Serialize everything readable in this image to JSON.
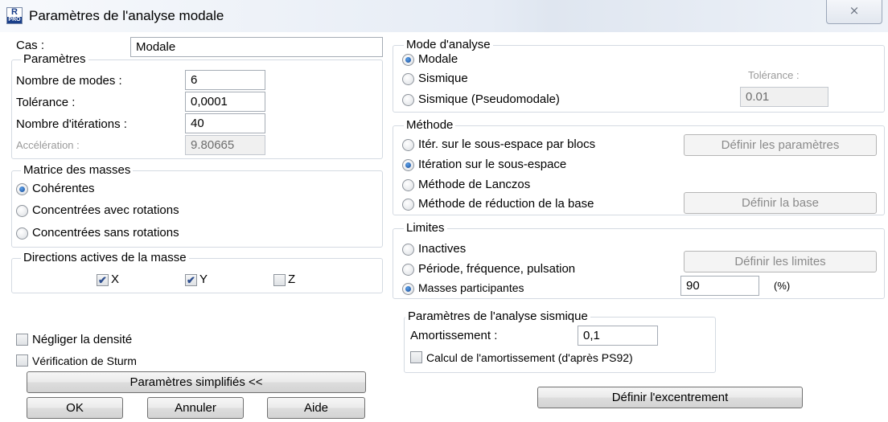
{
  "window": {
    "app_icon_top": "R",
    "app_icon_bottom": "PRO",
    "title": "Paramètres de l'analyse modale",
    "close": "⨯"
  },
  "cas": {
    "label": "Cas :",
    "value": "Modale"
  },
  "parametres": {
    "title": "Paramètres",
    "nb_modes_label": "Nombre de modes :",
    "nb_modes_value": "6",
    "tolerance_label": "Tolérance :",
    "tolerance_value": "0,0001",
    "iterations_label": "Nombre d'itérations :",
    "iterations_value": "40",
    "acceleration_label": "Accélération :",
    "acceleration_value": "9.80665"
  },
  "matrice": {
    "title": "Matrice des masses",
    "options": [
      "Cohérentes",
      "Concentrées avec rotations",
      "Concentrées sans rotations"
    ],
    "selected": "Cohérentes"
  },
  "directions": {
    "title": "Directions actives de la masse",
    "x_label": "X",
    "x_checked": true,
    "y_label": "Y",
    "y_checked": true,
    "z_label": "Z",
    "z_checked": false
  },
  "options": {
    "negliger_label": "Négliger la densité",
    "sturm_label": "Vérification de Sturm"
  },
  "buttons": {
    "simplified": "Paramètres simplifiés <<",
    "ok": "OK",
    "annuler": "Annuler",
    "aide": "Aide",
    "excentrement": "Définir l'excentrement"
  },
  "mode_analyse": {
    "title": "Mode d'analyse",
    "options": [
      "Modale",
      "Sismique",
      "Sismique (Pseudomodale)"
    ],
    "selected": "Modale",
    "tolerance_label": "Tolérance :",
    "tolerance_value": "0.01"
  },
  "methode": {
    "title": "Méthode",
    "options": [
      "Itér. sur le sous-espace par blocs",
      "Itération sur le sous-espace",
      "Méthode de Lanczos",
      "Méthode de réduction de la base"
    ],
    "selected": "Itération sur le sous-espace",
    "definir_parametres": "Définir les paramètres",
    "definir_base": "Définir la base"
  },
  "limites": {
    "title": "Limites",
    "options": [
      "Inactives",
      "Période, fréquence, pulsation",
      "Masses participantes"
    ],
    "selected": "Masses participantes",
    "definir_limites": "Définir les limites",
    "value": "90",
    "unit": "(%)"
  },
  "sismique": {
    "title": "Paramètres de l'analyse sismique",
    "amortissement_label": "Amortissement :",
    "amortissement_value": "0,1",
    "calcul_label": "Calcul de l'amortissement (d'après PS92)"
  }
}
